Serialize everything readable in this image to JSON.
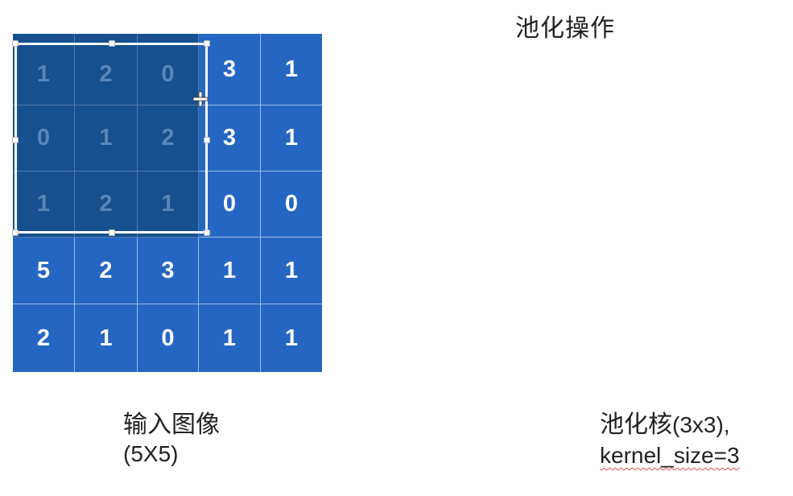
{
  "title": "池化操作",
  "input_grid": {
    "rows": [
      [
        "1",
        "2",
        "0",
        "3",
        "1"
      ],
      [
        "0",
        "1",
        "2",
        "3",
        "1"
      ],
      [
        "1",
        "2",
        "1",
        "0",
        "0"
      ],
      [
        "5",
        "2",
        "3",
        "1",
        "1"
      ],
      [
        "2",
        "1",
        "0",
        "1",
        "1"
      ]
    ],
    "covered_rows": 3,
    "covered_cols": 3
  },
  "captions": {
    "input_line1": "输入图像",
    "input_line2": "(5X5)",
    "kernel_line1": "池化核",
    "kernel_line1_paren": "(3x3),",
    "kernel_line2": "kernel_size=3"
  },
  "colors": {
    "grid_bg": "#2566c2",
    "covered_bg": "#16508f",
    "covered_text": "#5a86b8",
    "cell_text": "#ffffff"
  },
  "icons": {
    "cursor": "resize-cursor-icon"
  }
}
